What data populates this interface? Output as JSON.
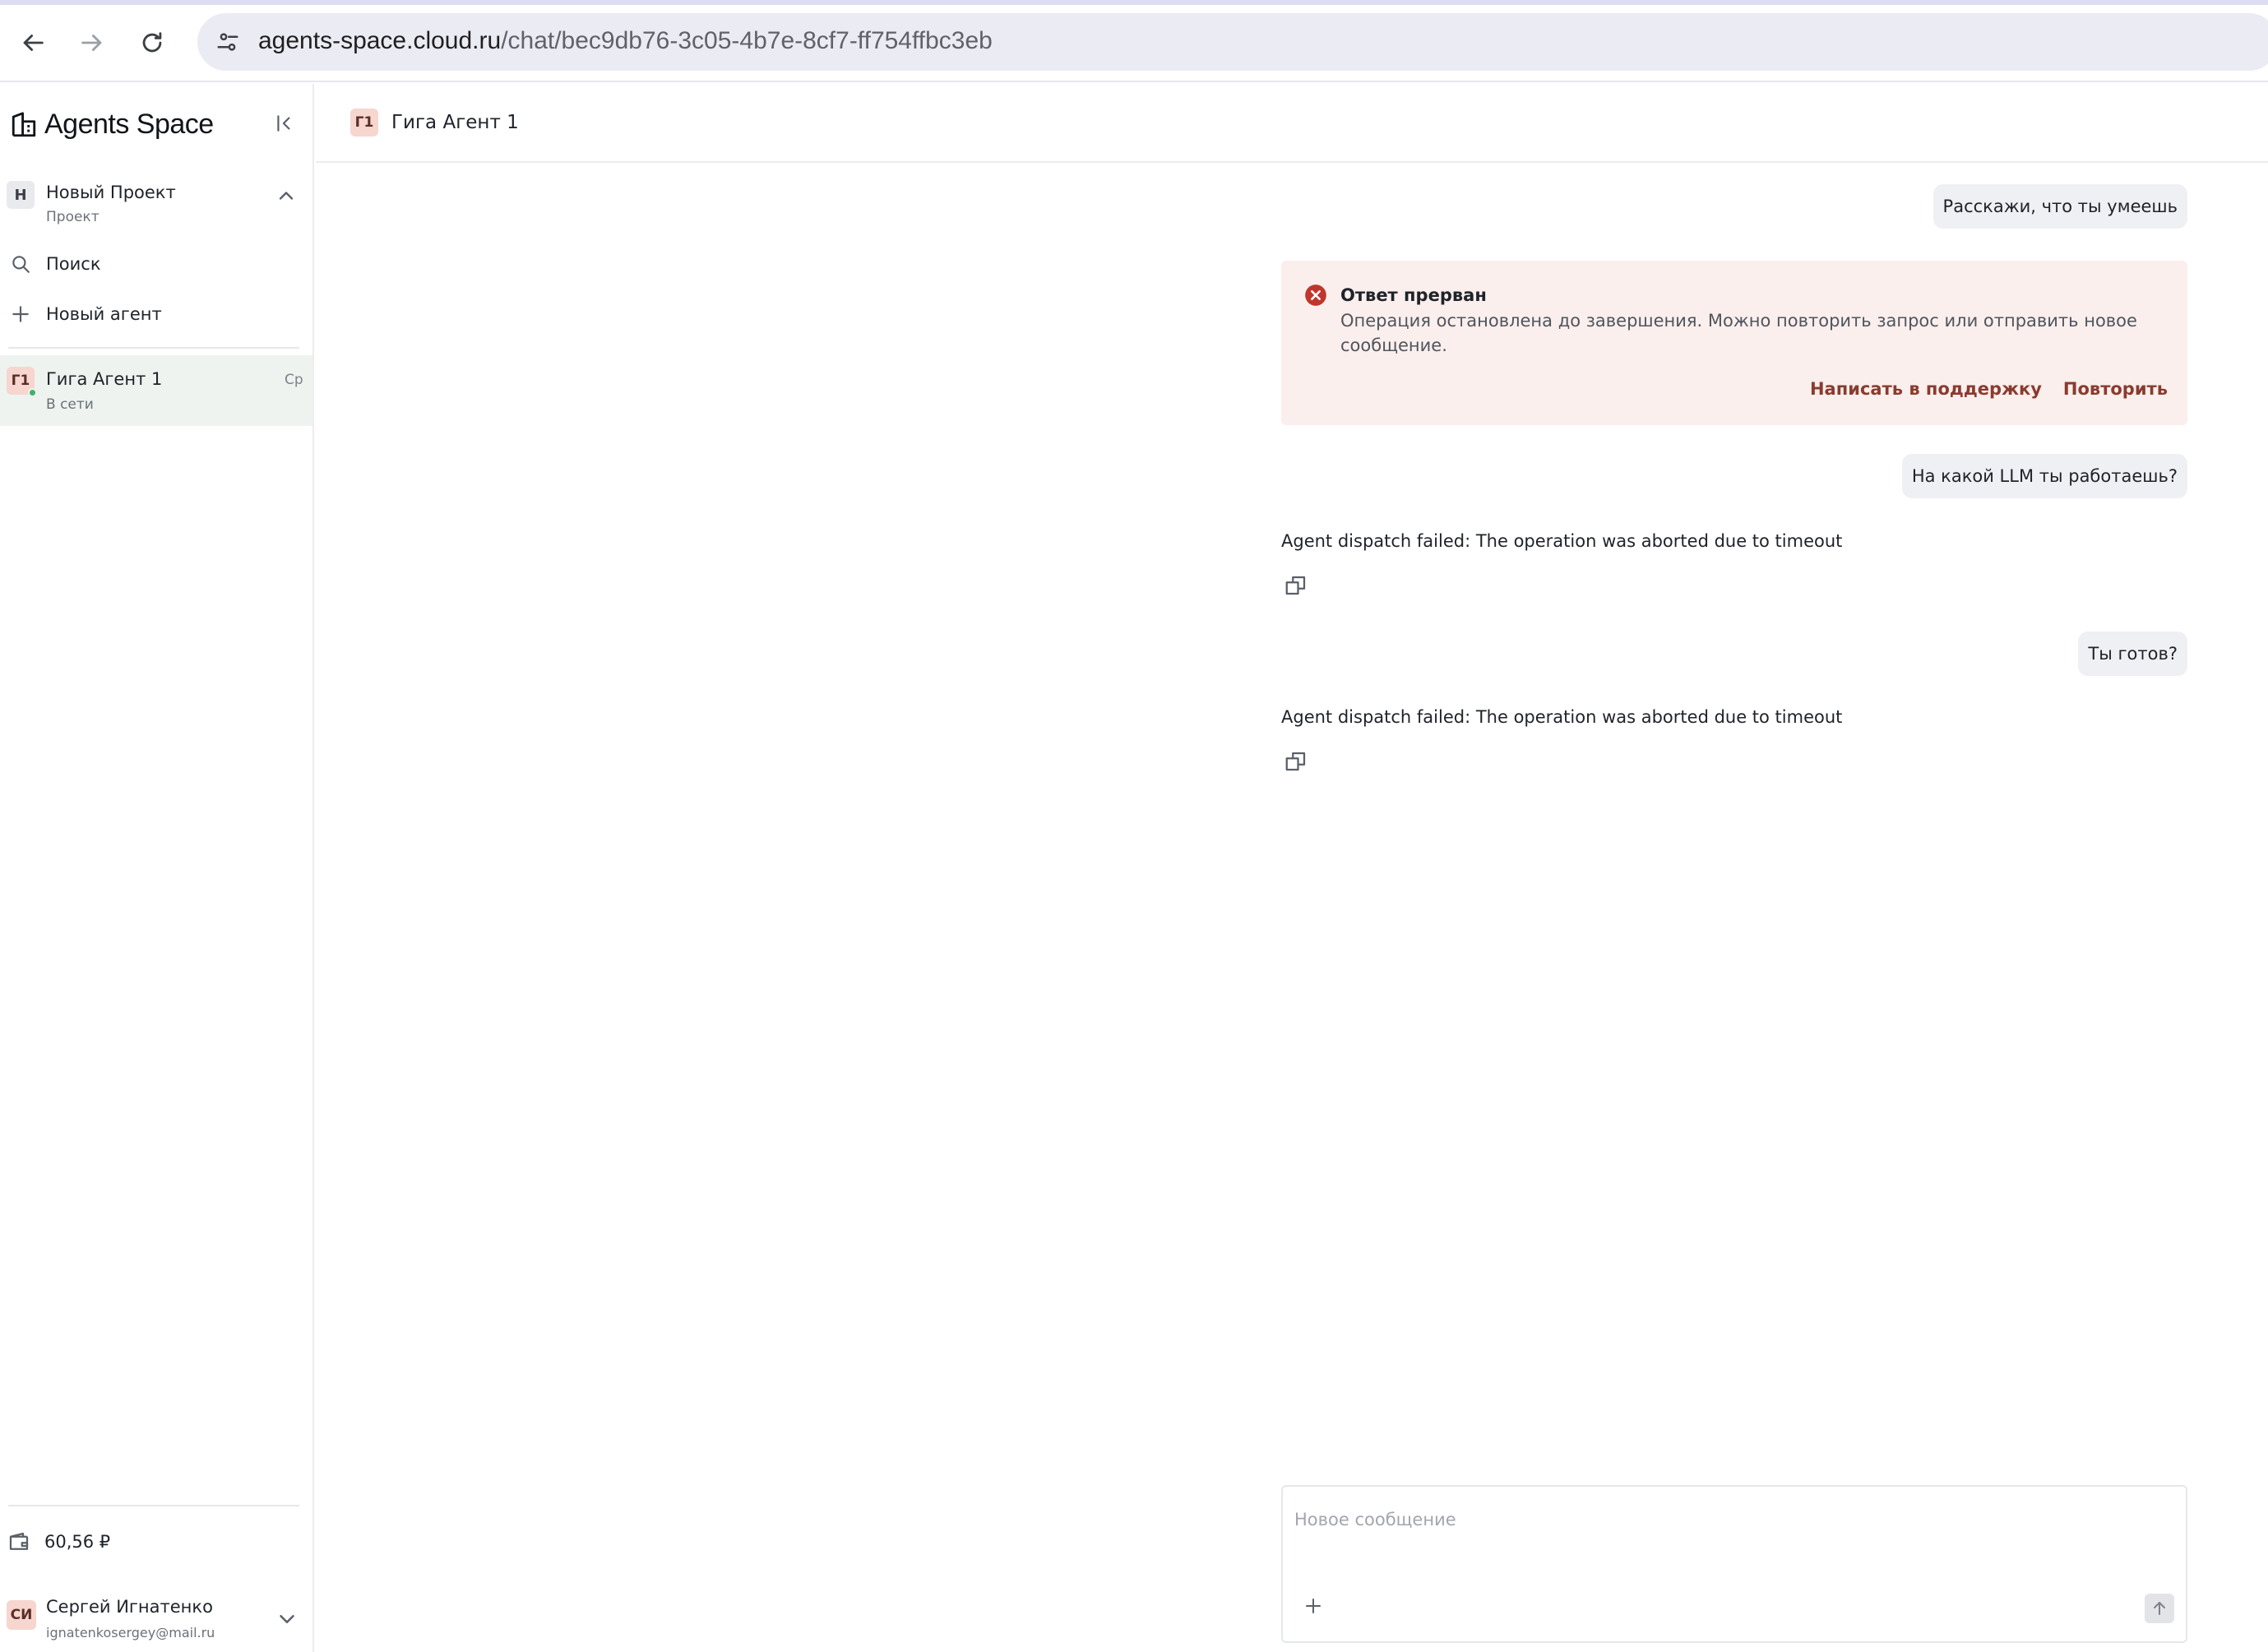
{
  "browser": {
    "url_host": "agents-space.cloud.ru",
    "url_path": "/chat/bec9db76-3c05-4b7e-8cf7-ff754ffbc3eb"
  },
  "sidebar": {
    "brand": "Agents Space",
    "project": {
      "avatar": "Н",
      "name": "Новый Проект",
      "subtitle": "Проект"
    },
    "search_label": "Поиск",
    "new_agent_label": "Новый агент",
    "agents": [
      {
        "avatar": "Г1",
        "name": "Гига Агент 1",
        "status": "В сети",
        "badge": "Ср"
      }
    ],
    "balance": "60,56 ₽",
    "user": {
      "avatar": "СИ",
      "name": "Сергей Игнатенко",
      "email": "ignatenkosergey@mail.ru"
    }
  },
  "chat": {
    "header": {
      "avatar": "Г1",
      "title": "Гига Агент 1"
    },
    "messages": [
      {
        "role": "user",
        "text": "Расскажи, что ты умеешь"
      },
      {
        "role": "error",
        "title": "Ответ прерван",
        "text": "Операция остановлена до завершения. Можно повторить запрос или отправить новое сообщение.",
        "support_label": "Написать в поддержку",
        "retry_label": "Повторить"
      },
      {
        "role": "user",
        "text": "На какой LLM ты работаешь?"
      },
      {
        "role": "agent",
        "text": "Agent dispatch failed: The operation was aborted due to timeout"
      },
      {
        "role": "user",
        "text": "Ты готов?"
      },
      {
        "role": "agent",
        "text": "Agent dispatch failed: The operation was aborted due to timeout"
      }
    ],
    "composer": {
      "placeholder": "Новое сообщение"
    }
  },
  "colors": {
    "error_bg": "#faefed",
    "error_icon": "#c0362c",
    "error_link": "#8a3b2f",
    "user_bubble": "#eff0f3",
    "active_item": "#eef3ef",
    "online": "#3db36b",
    "agent_avatar": "#f6d6cf"
  },
  "icons": [
    "back-icon",
    "forward-icon",
    "reload-icon",
    "site-info-icon",
    "logo-icon",
    "collapse-sidebar-icon",
    "chevron-up-icon",
    "search-icon",
    "plus-icon",
    "wallet-icon",
    "chevron-down-icon",
    "error-icon",
    "copy-icon",
    "attach-icon",
    "send-icon"
  ]
}
